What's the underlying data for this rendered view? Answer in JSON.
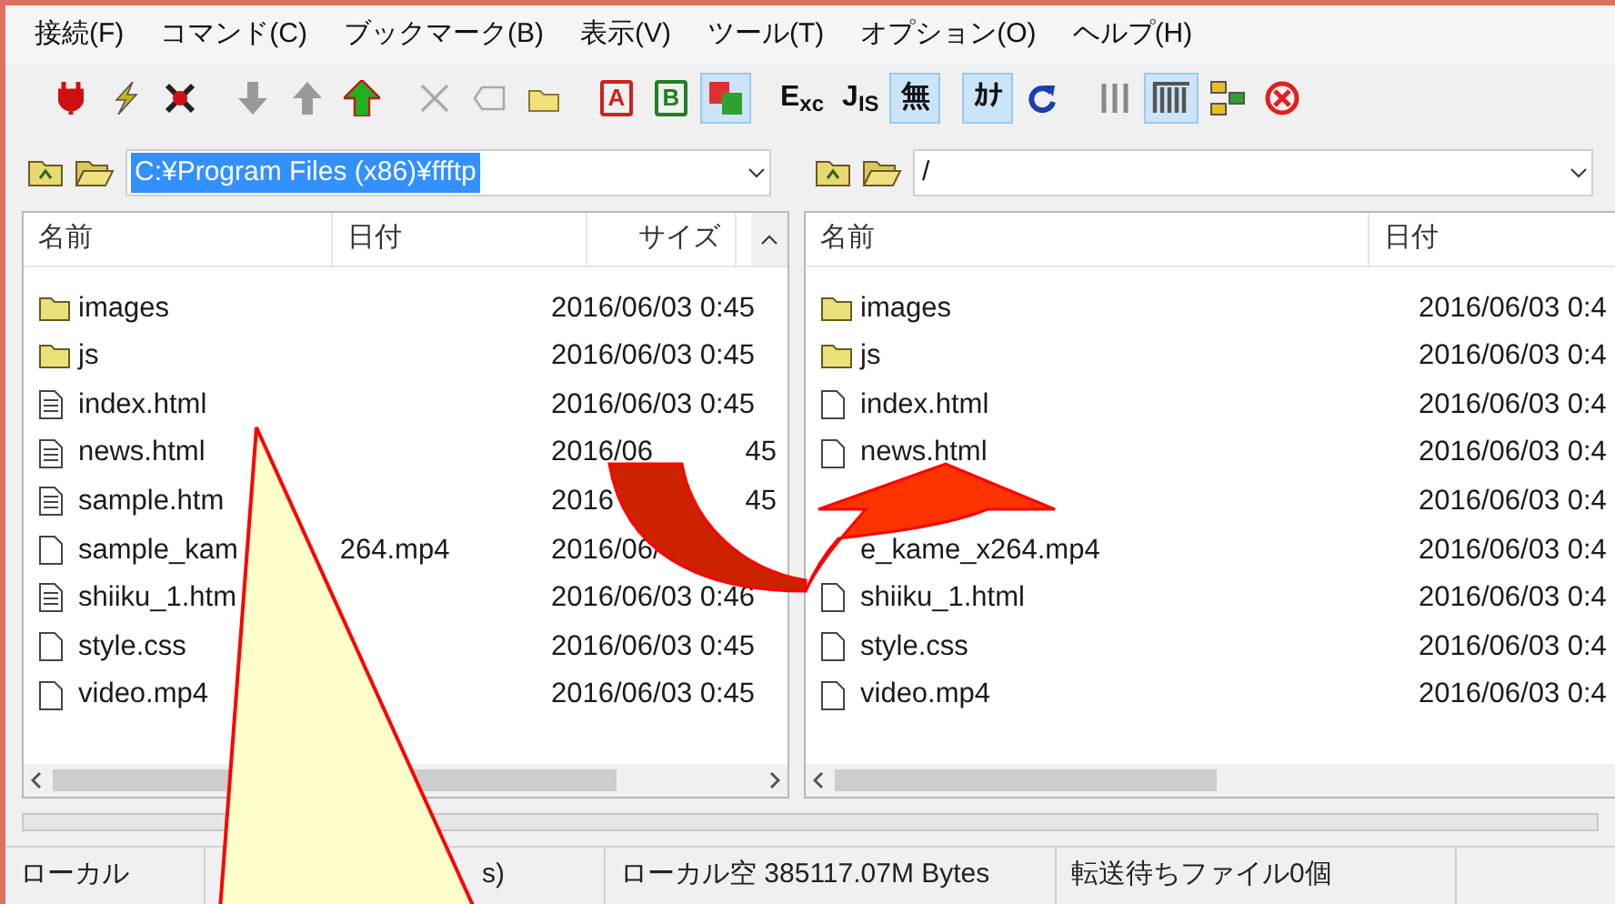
{
  "menu": [
    "接続(F)",
    "コマンド(C)",
    "ブックマーク(B)",
    "表示(V)",
    "ツール(T)",
    "オプション(O)",
    "ヘルプ(H)"
  ],
  "toolbar": [
    {
      "kind": "plug",
      "pressed": false
    },
    {
      "kind": "bolt",
      "pressed": false
    },
    {
      "kind": "cross-plug",
      "pressed": false
    },
    {
      "kind": "sep"
    },
    {
      "kind": "down",
      "pressed": false
    },
    {
      "kind": "up",
      "pressed": false
    },
    {
      "kind": "green-up",
      "pressed": false
    },
    {
      "kind": "sep"
    },
    {
      "kind": "x",
      "pressed": false
    },
    {
      "kind": "rename",
      "pressed": false
    },
    {
      "kind": "folder",
      "pressed": false
    },
    {
      "kind": "sep"
    },
    {
      "kind": "boxed",
      "label": "A",
      "color": "#d02020",
      "pressed": false
    },
    {
      "kind": "boxed",
      "label": "B",
      "color": "#208020",
      "pressed": false
    },
    {
      "kind": "ab",
      "pressed": true
    },
    {
      "kind": "sep"
    },
    {
      "kind": "text",
      "label": "E$_{xc}$",
      "pressed": false
    },
    {
      "kind": "text",
      "label": "J$_{IS}$",
      "pressed": false
    },
    {
      "kind": "text",
      "label": "無",
      "pressed": true
    },
    {
      "kind": "sep"
    },
    {
      "kind": "text",
      "label": "ｶﾅ",
      "pressed": true
    },
    {
      "kind": "refresh",
      "pressed": false
    },
    {
      "kind": "sep"
    },
    {
      "kind": "list",
      "pressed": false
    },
    {
      "kind": "detail",
      "pressed": true
    },
    {
      "kind": "sync",
      "pressed": false
    },
    {
      "kind": "stop",
      "pressed": false
    }
  ],
  "local": {
    "path": "C:¥Program Files (x86)¥ffftp",
    "path_selected": true,
    "columns": [
      "名前",
      "日付",
      "サイズ"
    ],
    "rows": [
      {
        "kind": "folder",
        "name": "images",
        "date": "2016/06/03  0:45"
      },
      {
        "kind": "folder",
        "name": "js",
        "date": "2016/06/03  0:45"
      },
      {
        "kind": "text",
        "name": "index.html",
        "date": "2016/06/03  0:45"
      },
      {
        "kind": "text",
        "name": "news.html",
        "date": "2016/06",
        "date_tail": "45"
      },
      {
        "kind": "text",
        "name": "sample.htm",
        "date": "2016",
        "date_tail": "45"
      },
      {
        "kind": "file",
        "name": "sample_kam",
        "name_tail": "264.mp4",
        "date": "2016/06/"
      },
      {
        "kind": "text",
        "name": "shiiku_1.htm",
        "date": "2016/06/03  0:46"
      },
      {
        "kind": "file",
        "name": "style.css",
        "date": "2016/06/03  0:45"
      },
      {
        "kind": "file",
        "name": "video.mp4",
        "date": "2016/06/03  0:45"
      }
    ]
  },
  "remote": {
    "path": "/",
    "path_selected": false,
    "columns": [
      "名前",
      "日付"
    ],
    "rows": [
      {
        "kind": "folder",
        "name": "images",
        "date": "2016/06/03  0:4"
      },
      {
        "kind": "folder",
        "name": "js",
        "date": "2016/06/03  0:4"
      },
      {
        "kind": "file",
        "name": "index.html",
        "date": "2016/06/03  0:4"
      },
      {
        "kind": "file",
        "name": "news.html",
        "date": "2016/06/03  0:4"
      },
      {
        "kind": "hidden",
        "date": "2016/06/03  0:4"
      },
      {
        "kind": "hidden",
        "name": "e_kame_x264.mp4",
        "date": "2016/06/03  0:4"
      },
      {
        "kind": "file",
        "name": "shiiku_1.html",
        "date": "2016/06/03  0:4"
      },
      {
        "kind": "file",
        "name": "style.css",
        "date": "2016/06/03  0:4"
      },
      {
        "kind": "file",
        "name": "video.mp4",
        "date": "2016/06/03  0:4"
      }
    ]
  },
  "status_bar": [
    "ローカル",
    "s)",
    "ローカル空 385117.07M Bytes",
    "転送待ちファイル0個"
  ]
}
